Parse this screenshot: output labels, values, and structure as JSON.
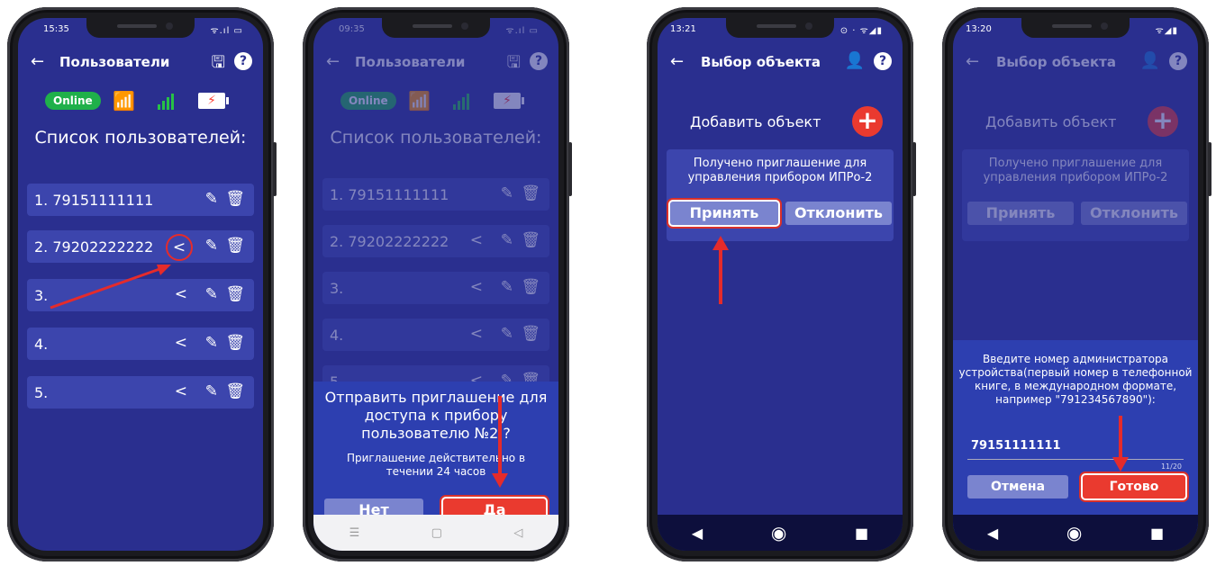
{
  "phone1": {
    "time": "15:35",
    "status_icons": "ᯤ.ıl ▭",
    "title": "Пользователи",
    "badge": "Online",
    "list_title": "Список пользователей:",
    "users": [
      "1. 79151111111",
      "2. 79202222222",
      "3.",
      "4.",
      "5."
    ]
  },
  "phone2": {
    "time": "09:35",
    "status_icons": "ᯤ.ıl ▭",
    "title": "Пользователи",
    "badge": "Online",
    "list_title": "Список пользователей:",
    "users": [
      "1. 79151111111",
      "2. 79202222222",
      "3.",
      "4.",
      "5."
    ],
    "dialog": {
      "line1": "Отправить приглашение для доступа к прибору пользователю №2 ?",
      "line2": "Приглашение действительно в течении 24 часов",
      "no": "Нет",
      "yes": "Да"
    }
  },
  "phone3": {
    "time": "13:21",
    "status_icons": "⊙ · ᯤ◢▮",
    "title": "Выбор объекта",
    "add_label": "Добавить объект",
    "invite_msg": "Получено приглашение для управления прибором ИПРо-2",
    "accept": "Принять",
    "decline": "Отклонить"
  },
  "phone4": {
    "time": "13:20",
    "status_icons": "ᯤ◢▮",
    "title": "Выбор объекта",
    "add_label": "Добавить объект",
    "invite_msg": "Получено приглашение для управления прибором ИПРо-2",
    "accept": "Принять",
    "decline": "Отклонить",
    "admin_prompt": "Введите номер администратора устройства(первый номер в телефонной книге, в международном формате, например \"791234567890\"):",
    "admin_value": "79151111111",
    "counter": "11/20",
    "cancel": "Отмена",
    "done": "Готово"
  },
  "colors": {
    "screen_bg": "#2a2f8f",
    "row_bg": "#3c45ad",
    "accent_red": "#ea3a2f",
    "online_green": "#1fb04a",
    "button_gray": "#7a84cf"
  }
}
